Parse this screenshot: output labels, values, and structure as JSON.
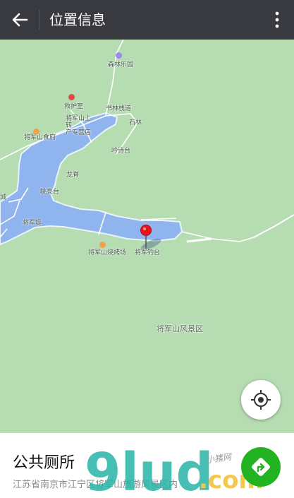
{
  "header": {
    "title": "位置信息"
  },
  "map": {
    "labels": {
      "top_poi": "森林乐园",
      "first_aid": "救护室",
      "plank_road": "书林栈道",
      "shop": "将军山上转\n产专营店",
      "stone_forest": "石林",
      "restaurant": "将军山食府",
      "poem_platform": "吟诗台",
      "dragon": "龙脊",
      "view_platform": "眺亮台",
      "lake_dike": "将军堤",
      "bbq": "将军山烧烤场",
      "marker_place": "将军钓台",
      "scenic_area": "将军山风景区",
      "left_cut": "城"
    }
  },
  "place": {
    "name": "公共厕所",
    "address": "江苏省南京市江宁区将军山旅游风景区内"
  },
  "watermark": {
    "brand": "9lud",
    "domain": ".com",
    "script": "小猪网"
  },
  "icons": {
    "back": "arrow-left-icon",
    "more": "more-vertical-icon",
    "locate": "locate-icon",
    "navigate": "navigate-icon"
  },
  "colors": {
    "header": "#393a3f",
    "map_land": "#b6dcb2",
    "water": "#8fb4ee",
    "marker": "#e8141b",
    "nav": "#22b322"
  }
}
